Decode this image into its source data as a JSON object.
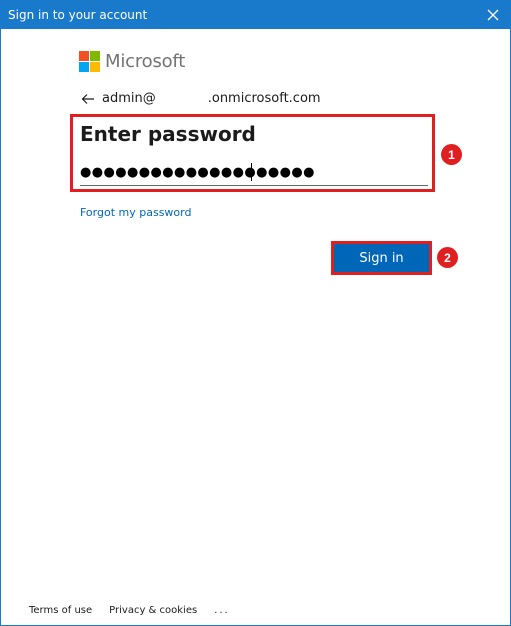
{
  "window": {
    "title": "Sign in to your account",
    "accent_color": "#1979ca",
    "close_icon": "close-icon"
  },
  "brand": {
    "name": "Microsoft",
    "squares": [
      "#f25022",
      "#7fba00",
      "#00a4ef",
      "#ffb900"
    ]
  },
  "identity": {
    "back_icon": "back-arrow-icon",
    "user_prefix": "admin@",
    "domain_suffix": ".onmicrosoft.com"
  },
  "password": {
    "heading": "Enter password",
    "masked_value": "●●●●●●●●●●●●●●●●●●●●"
  },
  "links": {
    "forgot": "Forgot my password"
  },
  "actions": {
    "signin_label": "Sign in",
    "signin_color": "#0067b8"
  },
  "annotations": {
    "highlight_color": "#e02020",
    "step1": "1",
    "step2": "2"
  },
  "footer": {
    "terms": "Terms of use",
    "privacy": "Privacy & cookies",
    "more": "..."
  }
}
